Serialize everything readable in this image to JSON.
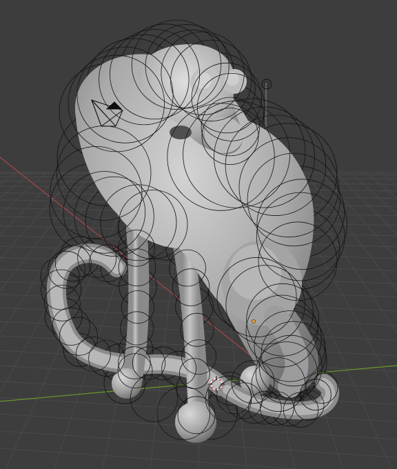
{
  "app": "3D viewport",
  "viewport": {
    "background_color": "#3d3d3d",
    "grid_color": "#4a4a4a",
    "x_axis_color": "#a8464b",
    "y_axis_color": "#6a9a2a",
    "z_axis_color": "#8a8a8a"
  },
  "model": {
    "shading": "solid",
    "base_color": "#a9a9a9",
    "shadow_color": "#6f6f6f",
    "metaball_outline_color": "#151515"
  },
  "overlays": {
    "camera_icon": "camera-icon",
    "light_icon": "light-icon",
    "origin_marker_color": "#e0a040",
    "cursor_icon": "3d-cursor-icon"
  }
}
